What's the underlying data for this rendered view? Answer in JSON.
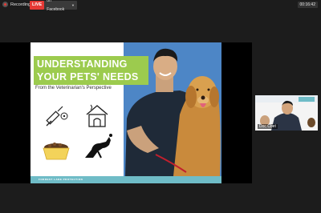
{
  "topbar": {
    "recording_label": "Recording",
    "live_badge": "LIVE",
    "live_target": "on Facebook",
    "timer": "00:16:42"
  },
  "slide": {
    "title_line1": "UNDERSTANDING",
    "title_line2": "YOUR PETS' NEEDS",
    "subtitle": "From the Veterinarian's Perspective",
    "footer": "FORREST LANE PROTECTION",
    "colors": {
      "title_bg": "#9ccb4e",
      "photo_bg": "#4d86c6",
      "footer": "#6fbcc7"
    }
  },
  "participant": {
    "name": "Doc Cbet"
  }
}
